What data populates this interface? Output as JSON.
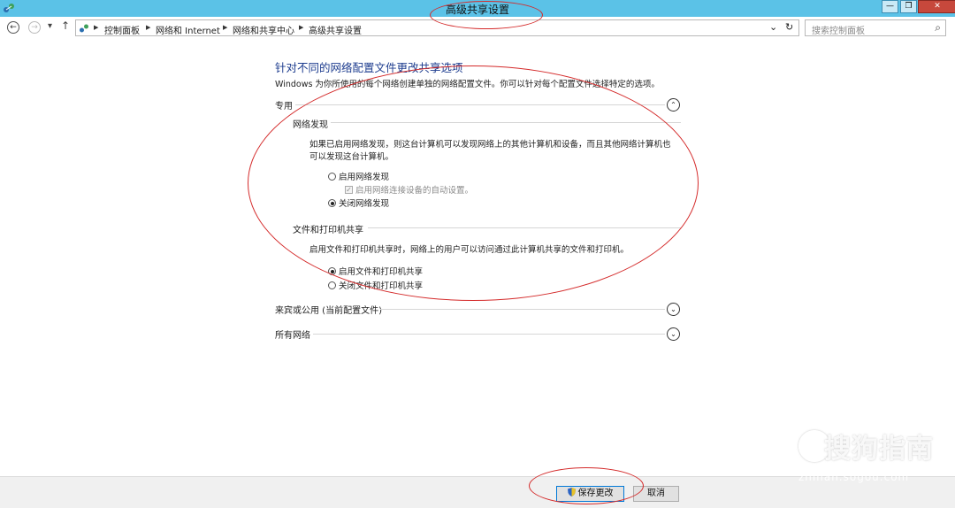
{
  "window": {
    "title": "高级共享设置",
    "minimize": "—",
    "restore": "❐",
    "close": "✕"
  },
  "nav": {
    "back": "←",
    "forward": "→",
    "recent": "▾",
    "up": "↑",
    "breadcrumbs": [
      "控制面板",
      "网络和 Internet",
      "网络和共享中心",
      "高级共享设置"
    ],
    "dropdown": "⌄",
    "refresh": "↻",
    "search_placeholder": "搜索控制面板",
    "search_icon": "⌕"
  },
  "main": {
    "heading": "针对不同的网络配置文件更改共享选项",
    "description": "Windows 为你所使用的每个网络创建单独的网络配置文件。你可以针对每个配置文件选择特定的选项。",
    "profiles": [
      {
        "label": "专用",
        "expanded": true,
        "toggle": "⌃"
      },
      {
        "label": "来宾或公用 (当前配置文件)",
        "expanded": false,
        "toggle": "⌄"
      },
      {
        "label": "所有网络",
        "expanded": false,
        "toggle": "⌄"
      }
    ],
    "network_discovery": {
      "title": "网络发现",
      "description": "如果已启用网络发现，则这台计算机可以发现网络上的其他计算机和设备，而且其他网络计算机也可以发现这台计算机。",
      "option_on": "启用网络发现",
      "option_auto": "启用网络连接设备的自动设置。",
      "option_off": "关闭网络发现",
      "selected": "off"
    },
    "file_sharing": {
      "title": "文件和打印机共享",
      "description": "启用文件和打印机共享时，网络上的用户可以访问通过此计算机共享的文件和打印机。",
      "option_on": "启用文件和打印机共享",
      "option_off": "关闭文件和打印机共享",
      "selected": "on"
    }
  },
  "footer": {
    "save": "保存更改",
    "cancel": "取消"
  },
  "watermark": {
    "brand": "搜狗指南",
    "url": "zhinan.sogou.com"
  },
  "colors": {
    "titlebar": "#5bc2e7",
    "heading": "#1e3d8f",
    "annotation": "#d42a2a",
    "close": "#c7483c"
  }
}
